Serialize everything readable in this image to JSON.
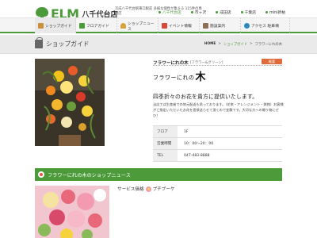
{
  "header": {
    "logo_prefix": "Shopping",
    "logo_text": "ELM",
    "logo_brand": "your",
    "store_name": "八千代台店",
    "description": "京成八千代台駅東口駅前 多様な個性が集まる 115件の専門店",
    "top_links": [
      {
        "label": "八千代台店",
        "active": true
      },
      {
        "label": "市ヶ沢",
        "active": false
      },
      {
        "label": "成田店",
        "active": false
      },
      {
        "label": "千葉店",
        "active": false
      },
      {
        "label": "mini新柏",
        "active": false
      }
    ]
  },
  "mainnav": {
    "items": [
      {
        "label": "ショップガイド",
        "icon": "shop-icon"
      },
      {
        "label": "フロアガイド",
        "icon": "floor-icon"
      },
      {
        "label": "ショップニュース",
        "icon": "news-icon"
      },
      {
        "label": "イベント情報",
        "icon": "event-icon"
      },
      {
        "label": "施設案内",
        "icon": "site-icon"
      },
      {
        "label": "アクセス 駐車場",
        "icon": "access-icon"
      }
    ]
  },
  "page": {
    "title": "ショップガイド",
    "breadcrumb": [
      "HOME",
      "ショップガイド",
      "フラワーにれの木"
    ]
  },
  "shop": {
    "name": "フラワーにれの木",
    "category": "[フラワー&グリーン]",
    "badge": "概要",
    "logo_text": "フラワーにれの",
    "logo_mark": "木",
    "catch": "四季折々のお花を貴方に提供いたします。",
    "description": "当店では生産者での地元配送も承っております。（花束・アレンジメント・鉢物）お客様がご指定いただいたお花を直接送らせて頂くので宜敷です。大切な方への贈り物にぜひ！",
    "info": [
      {
        "label": "フロア",
        "value": "1F"
      },
      {
        "label": "営業時間",
        "value": "10：00～20：00"
      },
      {
        "label": "TEL",
        "value": "047-483-8888"
      }
    ]
  },
  "news": {
    "title": "フラワーにれの木のショップニュース",
    "items": [
      {
        "text_before": "サービス価格",
        "text_after": "プチブーケ"
      }
    ]
  }
}
